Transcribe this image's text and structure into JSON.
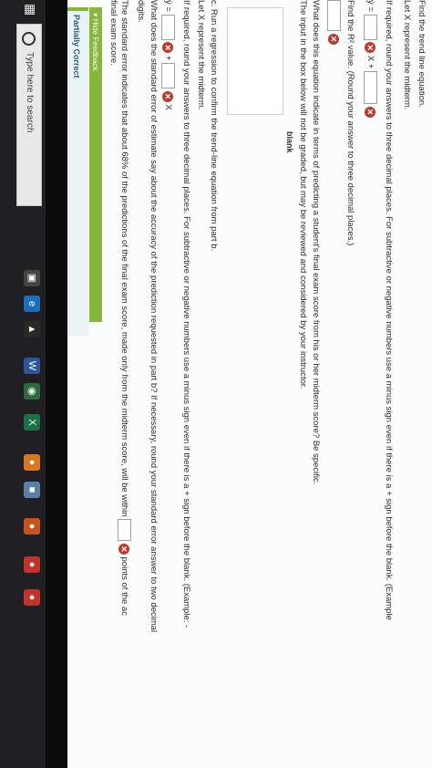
{
  "question": {
    "trend_title": "Find the trend line equation.",
    "let_x_midterm": "Let X represent the midterm.",
    "round_instructions": "If required, round your answers to three decimal places. For subtractive or negative numbers use a minus sign even if there is a + sign before the blank. (Example",
    "yhat_label": "ŷ =",
    "x_plus": "X +",
    "r2_prompt": "Find the R² value. (Round your answer to three decimal places.)",
    "equation_question": "What does this equation indicate in terms of predicting a student's final exam score from his or her midterm score? Be specific.",
    "input_note": "The input in the box below will not be graded, but may be reviewed and considered by your instructor.",
    "blank_label": "blank",
    "part_c": "c. Run a regression to confirm the trend-line equation from part b.",
    "let_x_midterm_2": "Let X represent the midterm.",
    "round_instructions_2": "If required, round your answers to three decimal places. For subtractive or negative numbers use a minus sign even if there is a + sign before the blank. (Example: -",
    "yhat_label_2": "ŷ =",
    "x_plus_2": "+",
    "x_label_2": "X",
    "std_error_question": "What does the standard error of estimate say about the accuracy of the prediction requested in part b? If necessary, round your standard error answer to two decimal",
    "digits": "digits.",
    "std_error_statement": "The standard error indicates that about 68% of the predictions of the final exam score, made only from the midterm score, will be within",
    "points_of_the": "points of the ac",
    "final_exam_score": "final exam score.",
    "hide_feedback": "▾ Hide Feedback",
    "partially_correct": "Partially Correct",
    "wrong_mark": "✕"
  },
  "taskbar": {
    "search_placeholder": "Type here to search",
    "start_icon": "windows-start-icon",
    "icons": [
      "task-view-icon",
      "edge-icon",
      "store-icon",
      "word-icon",
      "chrome-icon",
      "excel-icon",
      "firefox-icon",
      "photos-icon",
      "app-icon",
      "app-icon-2",
      "app-icon-3"
    ]
  },
  "colors": {
    "wrong": "#c0392b",
    "feedback_green": "#86b63a",
    "taskbar_bg": "#1f1f24"
  }
}
